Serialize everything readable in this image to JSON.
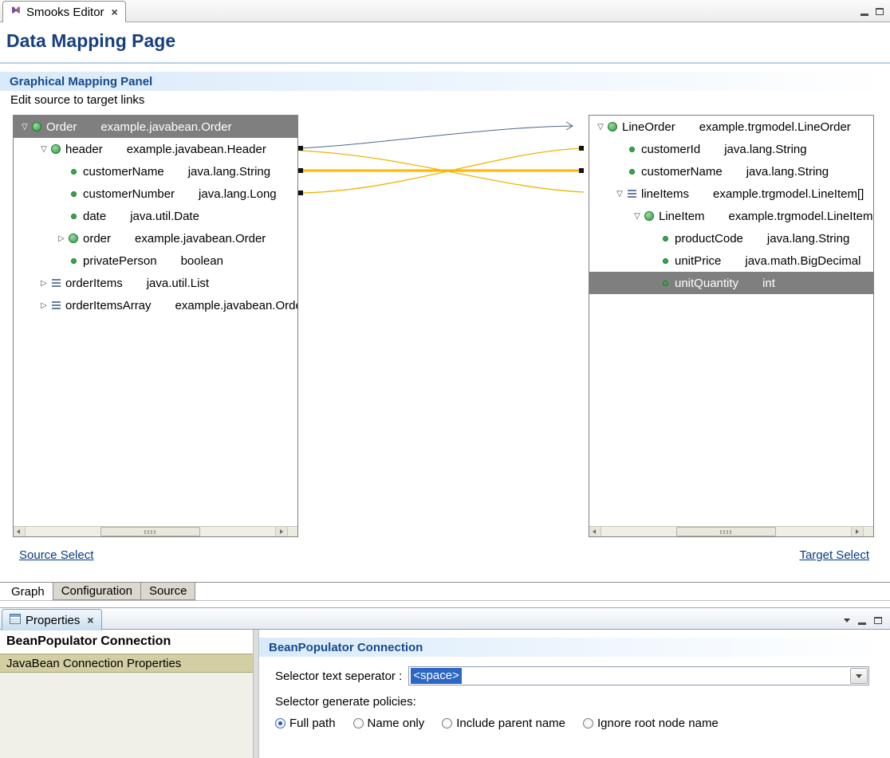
{
  "colors": {
    "heading": "#173f7e",
    "section_title": "#174a8c",
    "link": "#063a82",
    "tree_selection": "#7f7f7f",
    "combo_selection": "#2d66c4",
    "list_selection": "#d3cfa3",
    "line_navy": "#50678a",
    "line_yellow": "#eeb500",
    "line_selected": "#ffb400"
  },
  "editor": {
    "tab": "Smooks Editor",
    "close_glyph": "×",
    "page_title": "Data Mapping Page",
    "panel_title": "Graphical Mapping Panel",
    "panel_subtitle": "Edit source to target links",
    "source_select": "Source Select",
    "target_select": "Target Select",
    "bottom_tabs": [
      {
        "label": "Graph",
        "active": true
      },
      {
        "label": "Configuration"
      },
      {
        "label": "Source"
      }
    ]
  },
  "source_tree": {
    "rows": [
      {
        "level": 0,
        "expand": "open",
        "icon": "class",
        "name": "Order",
        "type": "example.javabean.Order",
        "selected": true
      },
      {
        "level": 1,
        "expand": "open",
        "icon": "class",
        "name": "header",
        "type": "example.javabean.Header"
      },
      {
        "level": 2,
        "expand": "none",
        "icon": "property",
        "name": "customerName",
        "type": "java.lang.String"
      },
      {
        "level": 2,
        "expand": "none",
        "icon": "property",
        "name": "customerNumber",
        "type": "java.lang.Long"
      },
      {
        "level": 2,
        "expand": "none",
        "icon": "property",
        "name": "date",
        "type": "java.util.Date"
      },
      {
        "level": 2,
        "expand": "closed",
        "icon": "class",
        "name": "order",
        "type": "example.javabean.Order"
      },
      {
        "level": 2,
        "expand": "none",
        "icon": "property",
        "name": "privatePerson",
        "type": "boolean"
      },
      {
        "level": 1,
        "expand": "closed",
        "icon": "list",
        "name": "orderItems",
        "type": "java.util.List"
      },
      {
        "level": 1,
        "expand": "closed",
        "icon": "list",
        "name": "orderItemsArray",
        "type": "example.javabean.OrderItem[]"
      }
    ]
  },
  "target_tree": {
    "rows": [
      {
        "level": 0,
        "expand": "open",
        "icon": "class",
        "name": "LineOrder",
        "type": "example.trgmodel.LineOrder"
      },
      {
        "level": 1,
        "expand": "none",
        "icon": "property",
        "name": "customerId",
        "type": "java.lang.String"
      },
      {
        "level": 1,
        "expand": "none",
        "icon": "property",
        "name": "customerName",
        "type": "java.lang.String"
      },
      {
        "level": 1,
        "expand": "open",
        "icon": "list",
        "name": "lineItems",
        "type": "example.trgmodel.LineItem[]"
      },
      {
        "level": 2,
        "expand": "open",
        "icon": "class",
        "name": "LineItem",
        "type": "example.trgmodel.LineItem"
      },
      {
        "level": 3,
        "expand": "none",
        "icon": "property",
        "name": "productCode",
        "type": "java.lang.String"
      },
      {
        "level": 3,
        "expand": "none",
        "icon": "property",
        "name": "unitPrice",
        "type": "java.math.BigDecimal"
      },
      {
        "level": 3,
        "expand": "none",
        "icon": "property",
        "name": "unitQuantity",
        "type": "int",
        "selected": true
      }
    ]
  },
  "mappings": [
    {
      "source": "header",
      "target": "LineOrder",
      "style": "navy-arrow"
    },
    {
      "source": "customerName",
      "target": "customerName",
      "style": "orange-selected"
    },
    {
      "source": "customerNumber",
      "target": "customerId",
      "style": "yellow"
    },
    {
      "source": "header",
      "target": "lineItems",
      "style": "yellow"
    }
  ],
  "properties": {
    "tab": "Properties",
    "close_glyph": "×",
    "left_items": [
      {
        "label": "BeanPopulator Connection",
        "header": true
      },
      {
        "label": "JavaBean Connection Properties",
        "selected": true
      }
    ],
    "section_title": "BeanPopulator Connection",
    "separator_label": "Selector text seperator :",
    "separator_value": "<space>",
    "policies_label": "Selector generate policies:",
    "policies": [
      {
        "label": "Full path",
        "selected": true
      },
      {
        "label": "Name only"
      },
      {
        "label": "Include parent name"
      },
      {
        "label": "Ignore root node name"
      }
    ]
  }
}
